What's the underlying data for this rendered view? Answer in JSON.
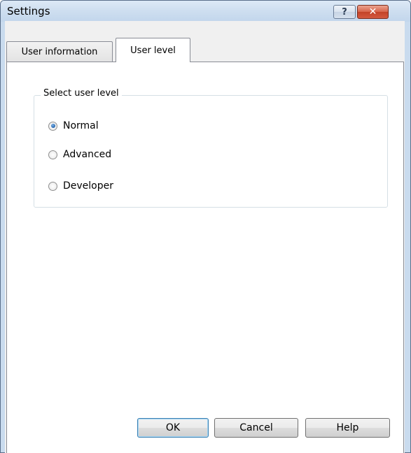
{
  "window": {
    "title": "Settings",
    "help_button": "?",
    "close_button": "✕"
  },
  "tabs": [
    {
      "label": "User information",
      "selected": false
    },
    {
      "label": "User level",
      "selected": true
    }
  ],
  "group": {
    "legend": "Select user level",
    "options": [
      {
        "label": "Normal",
        "checked": true
      },
      {
        "label": "Advanced",
        "checked": false
      },
      {
        "label": "Developer",
        "checked": false
      }
    ]
  },
  "buttons": {
    "ok": "OK",
    "cancel": "Cancel",
    "help": "Help"
  },
  "colors": {
    "accent": "#2263ad",
    "titlebar": "#cfdff0",
    "close": "#c24328"
  }
}
